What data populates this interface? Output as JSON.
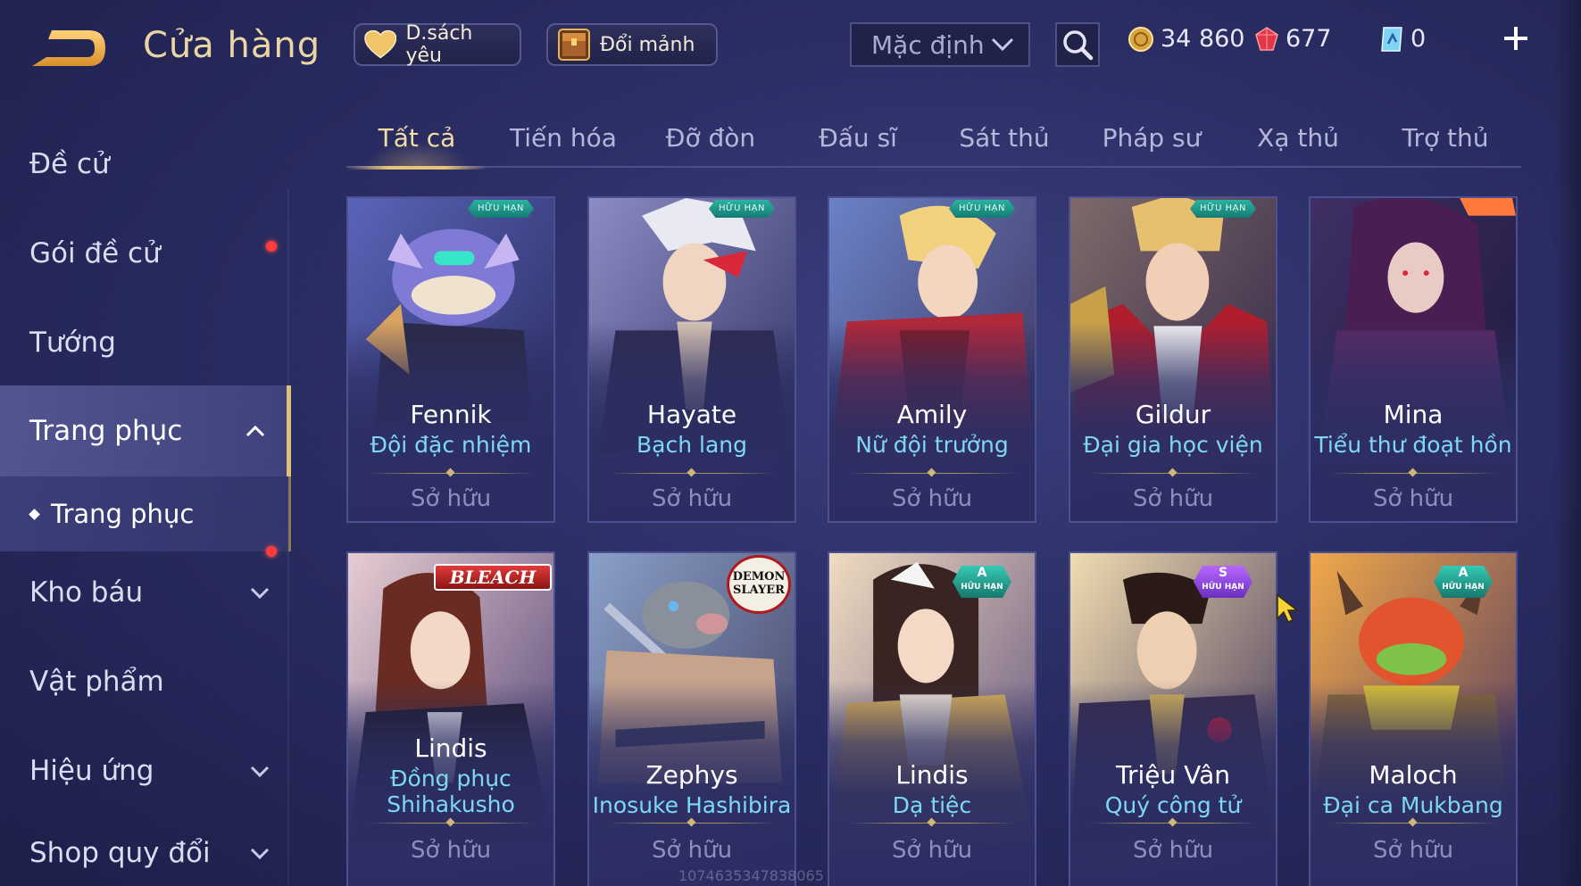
{
  "header": {
    "title": "Cửa hàng",
    "wishlist_label": "D.sách yêu",
    "exchange_label": "Đổi mảnh",
    "sort_value": "Mặc định",
    "gold": "34 860",
    "ruby": "677",
    "voucher": "0"
  },
  "sidebar": {
    "items": [
      {
        "label": "Đề cử"
      },
      {
        "label": "Gói đề cử"
      },
      {
        "label": "Tướng"
      },
      {
        "label": "Trang phục"
      },
      {
        "label": "Kho báu"
      },
      {
        "label": "Vật phẩm"
      },
      {
        "label": "Hiệu ứng"
      },
      {
        "label": "Shop quy đổi"
      }
    ],
    "sub_item": "Trang phục"
  },
  "tabs": [
    "Tất cả",
    "Tiến hóa",
    "Đỡ đòn",
    "Đấu sĩ",
    "Sát thủ",
    "Pháp sư",
    "Xạ thủ",
    "Trợ thủ"
  ],
  "badges": {
    "limited": "HỮU HẠN",
    "tier_a": "A",
    "tier_s": "S"
  },
  "logos": {
    "bleach": "BLEACH",
    "demon_slayer": "DEMON SLAYER"
  },
  "owned_label": "Sở hữu",
  "watermark": "1074635347838065",
  "cards": [
    {
      "hero": "Fennik",
      "skin": "Đội đặc nhiệm"
    },
    {
      "hero": "Hayate",
      "skin": "Bạch lang"
    },
    {
      "hero": "Amily",
      "skin": "Nữ đội trưởng"
    },
    {
      "hero": "Gildur",
      "skin": "Đại gia học viện"
    },
    {
      "hero": "Mina",
      "skin": "Tiểu thư đoạt hồn"
    },
    {
      "hero": "Lindis",
      "skin": "Đồng phục Shihakusho"
    },
    {
      "hero": "Zephys",
      "skin": "Inosuke Hashibira"
    },
    {
      "hero": "Lindis",
      "skin": "Dạ tiệc"
    },
    {
      "hero": "Triệu Vân",
      "skin": "Quý công tử"
    },
    {
      "hero": "Maloch",
      "skin": "Đại ca Mukbang"
    }
  ],
  "colors": {
    "accent_gold": "#e8c37a",
    "skin_text": "#7fd8f3",
    "background": "#2a2d63",
    "notify_dot": "#ff3b3b"
  }
}
